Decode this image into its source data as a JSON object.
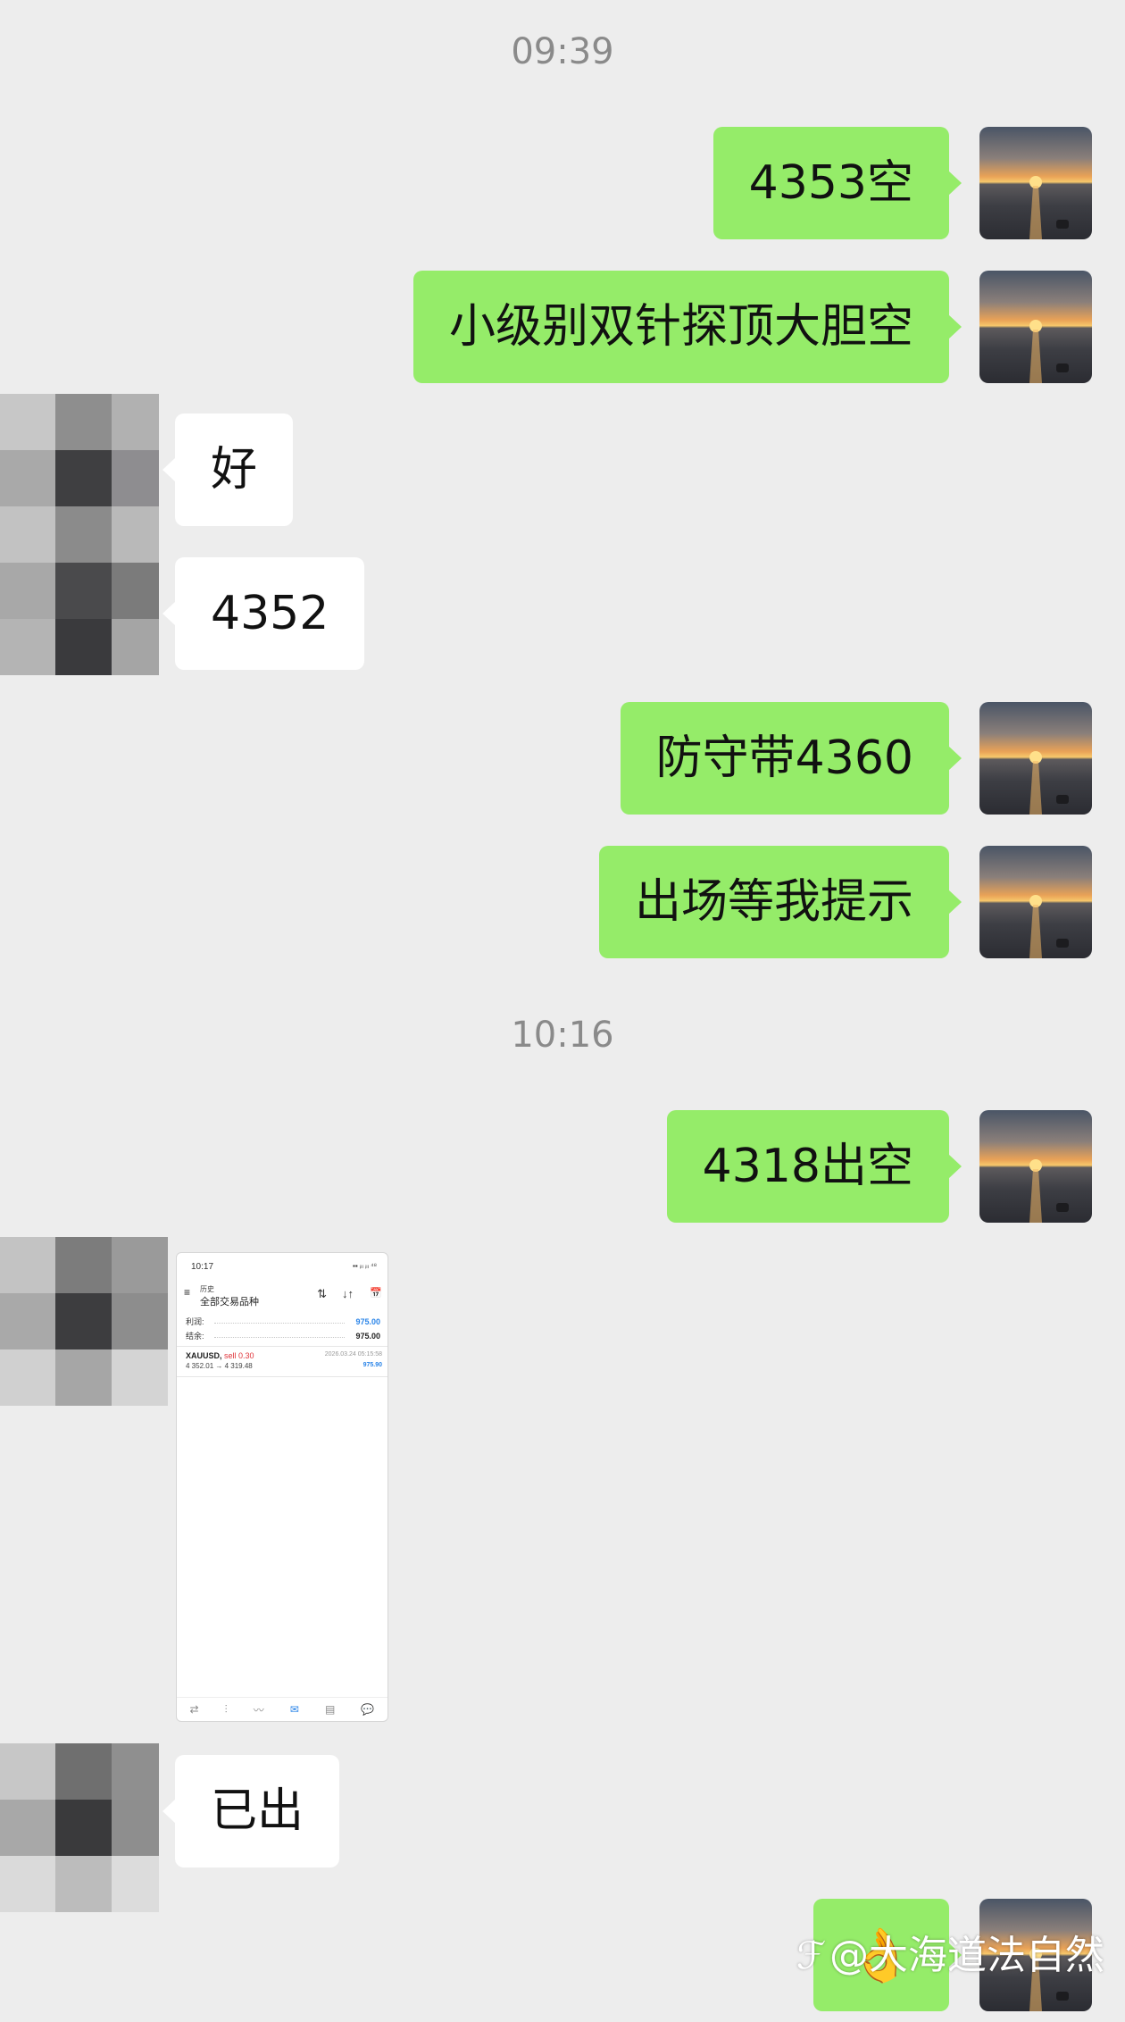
{
  "timestamps": [
    "09:39",
    "10:16"
  ],
  "messages": [
    {
      "text": "4353空"
    },
    {
      "text": "小级别双针探顶大胆空"
    },
    {
      "text": "好"
    },
    {
      "text": "4352"
    },
    {
      "text": "防守带4360"
    },
    {
      "text": "出场等我提示"
    },
    {
      "text": "4318出空"
    },
    {
      "text": "已出"
    },
    {
      "text": "👌"
    }
  ],
  "shared_screenshot": {
    "status_time": "10:17",
    "status_icons": "▪▪ ᵢₗₗ ᵢₗₗ ⁴⁸",
    "menu_icon": "≡",
    "title_small": "历史",
    "title": "全部交易品种",
    "toolbar_icons": [
      "⇅",
      "↓↑",
      "📅"
    ],
    "summary": [
      {
        "label": "利润:",
        "value": "975.00",
        "color": "#2a84e8"
      },
      {
        "label": "结余:",
        "value": "975.00",
        "color": "#222222"
      }
    ],
    "deal": {
      "symbol": "XAUUSD,",
      "side": "sell 0.30",
      "datetime": "2026.03.24 05:15:58",
      "prices": "4 352.01 → 4 319.48",
      "profit": "975.90"
    },
    "nav_icons": [
      "⇄",
      "⫶",
      "〰",
      "✉",
      "▤",
      "💬"
    ]
  },
  "watermark": {
    "logo": "ℱ",
    "text": "@大海道法自然"
  },
  "colors": {
    "outgoing_bubble": "#95ec69",
    "incoming_bubble": "#ffffff",
    "background": "#ededed",
    "timestamp": "#8a8a8a",
    "profit_blue": "#2a84e8",
    "sell_red": "#e0353b"
  },
  "icons": {
    "my_avatar": "sunset-avatar-icon",
    "other_avatar": "pixelated-avatar"
  }
}
